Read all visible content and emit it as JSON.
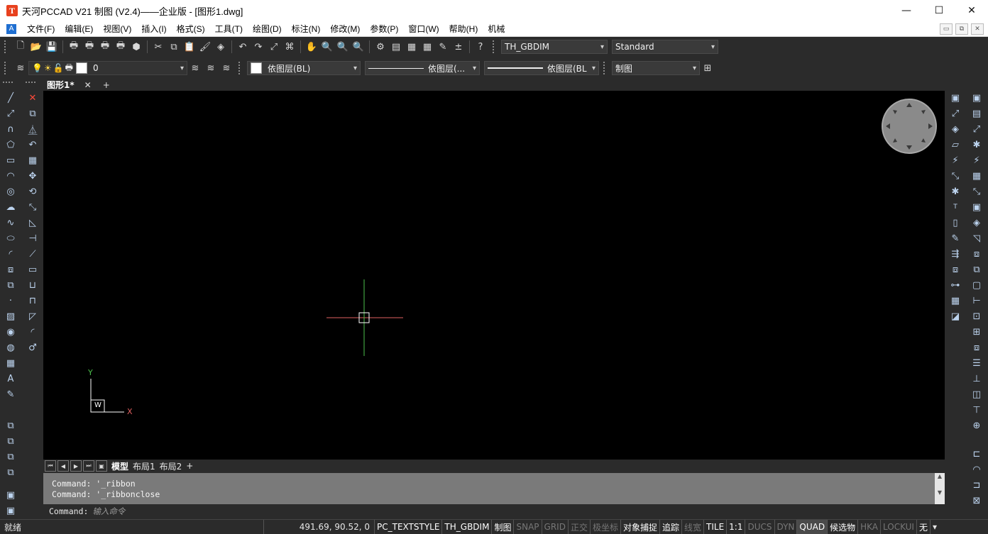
{
  "window": {
    "title": "天河PCCAD V21 制图 (V2.4)——企业版 - [图形1.dwg]",
    "logo_letter": "T",
    "buttons": [
      "—",
      "☐",
      "✕"
    ]
  },
  "menu": {
    "items": [
      "文件(F)",
      "编辑(E)",
      "视图(V)",
      "插入(I)",
      "格式(S)",
      "工具(T)",
      "绘图(D)",
      "标注(N)",
      "修改(M)",
      "参数(P)",
      "窗口(W)",
      "帮助(H)",
      "机械"
    ],
    "mdi_buttons": [
      "▭",
      "⧉",
      "✕"
    ]
  },
  "toolbar1": {
    "dimstyle": "TH_GBDIM",
    "textstyle": "Standard"
  },
  "toolbar2": {
    "layer": "0",
    "color": "依图层(BL)",
    "linetype": "依图层(...",
    "lineweight": "依图层(BL",
    "plotstyle": "制图"
  },
  "doc_tabs": {
    "active": "图形1*",
    "close": "✕",
    "add": "+"
  },
  "ucs": {
    "y_label": "Y",
    "x_label": "X",
    "w_label": "W"
  },
  "layout_tabs": {
    "tabs": [
      "模型",
      "布局1",
      "布局2"
    ],
    "active": "模型",
    "add": "+"
  },
  "command": {
    "history": [
      "Command: '_ribbon",
      "Command: '_ribbonclose"
    ],
    "prompt": "Command:",
    "placeholder": "输入命令"
  },
  "status": {
    "ready": "就绪",
    "coords": "491.69, 90.52, 0",
    "items": [
      {
        "label": "PC_TEXTSTYLE",
        "state": "on"
      },
      {
        "label": "TH_GBDIM",
        "state": "on"
      },
      {
        "label": "制图",
        "state": "on"
      },
      {
        "label": "SNAP",
        "state": "off"
      },
      {
        "label": "GRID",
        "state": "off"
      },
      {
        "label": "正交",
        "state": "off"
      },
      {
        "label": "极坐标",
        "state": "off"
      },
      {
        "label": "对象捕捉",
        "state": "on"
      },
      {
        "label": "追踪",
        "state": "on"
      },
      {
        "label": "线宽",
        "state": "off"
      },
      {
        "label": "TILE",
        "state": "on"
      },
      {
        "label": "1:1",
        "state": "on"
      },
      {
        "label": "DUCS",
        "state": "off"
      },
      {
        "label": "DYN",
        "state": "off"
      },
      {
        "label": "QUAD",
        "state": "active"
      },
      {
        "label": "候选物",
        "state": "on"
      },
      {
        "label": "HKA",
        "state": "off"
      },
      {
        "label": "LOCKUI",
        "state": "off"
      },
      {
        "label": "无",
        "state": "on"
      }
    ]
  }
}
